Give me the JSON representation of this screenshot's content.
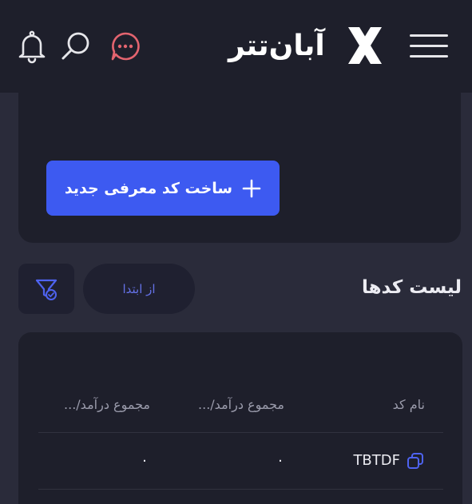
{
  "header": {
    "brand_name": "آبان‌تتر",
    "logo_mark": "X",
    "icons": [
      "menu-icon",
      "chat-icon",
      "search-icon",
      "bell-icon"
    ]
  },
  "create_card": {
    "create_button_label": "ساخت کد معرفی جدید"
  },
  "codes_section": {
    "title": "لیست کدها",
    "sort_label": "از ابتدا"
  },
  "table": {
    "columns": [
      "نام کد",
      "مجموع درآمد/...",
      "مجموع درآمد/..."
    ],
    "rows": [
      {
        "code": "TBTDF",
        "sum1": "۰",
        "sum2": "۰"
      }
    ]
  },
  "colors": {
    "background": "#2a2b3a",
    "panel": "#1e1f2b",
    "accent": "#3d5af1",
    "chat_icon": "#e3646f",
    "link": "#6572e8"
  }
}
